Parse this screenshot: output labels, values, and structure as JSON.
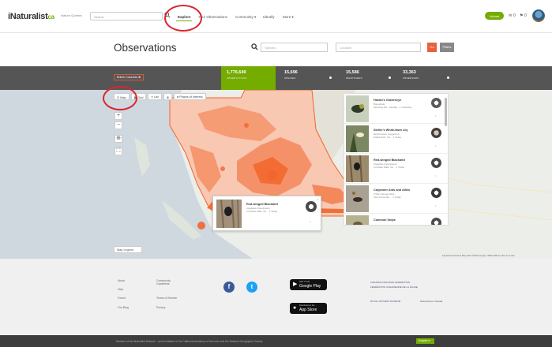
{
  "topnav": {
    "logo_main": "iNaturalist",
    "logo_suffix": "ca",
    "logo_sub": "Nature Québec",
    "search_placeholder": "Search",
    "links": [
      "Explore",
      "Your Observations",
      "Community ▾",
      "Identify",
      "More ▾"
    ],
    "upload_label": "Upload",
    "messages_count": "0",
    "notifications_count": "0"
  },
  "header": {
    "title": "Observations",
    "species_placeholder": "Species",
    "location_placeholder": "Location",
    "go_label": "Go",
    "filters_label": "Filters"
  },
  "stats": {
    "place": "British Columbia",
    "items": [
      {
        "value": "1,776,649",
        "label": "OBSERVATIONS"
      },
      {
        "value": "15,696",
        "label": "SPECIES"
      },
      {
        "value": "15,586",
        "label": "IDENTIFIERS"
      },
      {
        "value": "33,363",
        "label": "OBSERVERS"
      }
    ]
  },
  "map": {
    "view_tabs": [
      "Map",
      "Grid",
      "List",
      "⊕",
      "Places of Interest"
    ],
    "zoom_in": "+",
    "zoom_out": "−",
    "legend_label": "Map Legend",
    "attribution": "Keyboard shortcuts   Map data ©2024 Google, INEGI   500 km   Terms of Use",
    "accent_color": "#f2652b"
  },
  "observation_list": [
    {
      "name": "Harlan's Goldeneye",
      "sci": "Bucephala",
      "meta": "Flamingo Rd., Canada · 1 Yesterday",
      "count": "1"
    },
    {
      "name": "Steller's White-fawn Lily",
      "sci": "(Erythronium oregonum)",
      "meta": "Dallas Park, Vic. · 1 Today",
      "count": "1"
    },
    {
      "name": "Red-winged Blackbird",
      "sci": "(Agelaius phoeniceus)",
      "meta": "Lochside Walk, Vic. · 1 Today",
      "count": "1"
    },
    {
      "name": "Carpenter Ants and Allies",
      "sci": "(Tribe Camponotini)",
      "meta": "Tera Pointe Rd., · 1 Today",
      "count": "1"
    },
    {
      "name": "Common Snipe",
      "sci": "",
      "meta": "",
      "count": ""
    }
  ],
  "popup": {
    "name": "Red-winged Blackbird",
    "sci": "(Agelaius phoeniceus)",
    "meta": "Lochside Walk, Vic. · 1 Today",
    "count": "1",
    "close": "×"
  },
  "footer": {
    "col1": [
      "About",
      "Help",
      "Forum",
      "Our Blog"
    ],
    "col2": [
      "Community Guidelines",
      "Terms of Service",
      "Privacy"
    ],
    "store_google_small": "GET IT ON",
    "store_google": "Google Play",
    "store_apple_small": "Download on the",
    "store_apple": "App Store",
    "partner1": "CANADIAN WILDLIFE FEDERATION",
    "partner2": "FÉDÉRATION CANADIENNE DE LA FAUNE",
    "partner3": "ROYAL ONTARIO MUSEUM",
    "partner4": "NatureServe Canada",
    "bottom_text": "Member of the iNaturalist Network · a joint initiative of the California Academy of Sciences and the National Geographic Society",
    "language": "English ▾"
  }
}
